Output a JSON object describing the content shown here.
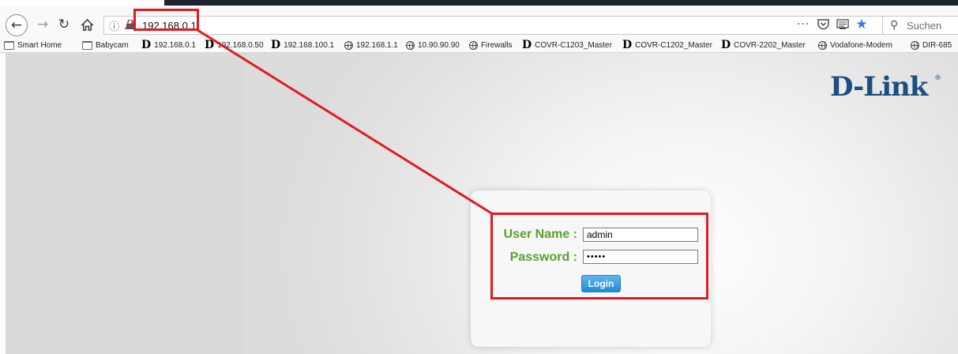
{
  "browser": {
    "url": "192.168.0.1",
    "search_placeholder": "Suchen",
    "icons": {
      "back": "arrow-left-icon",
      "forward": "arrow-right-icon",
      "reload": "reload-icon",
      "home": "home-icon",
      "info": "info-icon",
      "more": "more-icon",
      "pocket": "pocket-icon",
      "reader": "reader-view-icon",
      "bookmark_star": "star-icon",
      "search": "search-icon"
    },
    "accent_color": "#2f7ed8"
  },
  "bookmarks": [
    {
      "label": "Smart Home",
      "icon": "folder-icon"
    },
    {
      "label": "Babycam",
      "icon": "folder-icon"
    },
    {
      "label": "192.168.0.1",
      "icon": "dlink-icon"
    },
    {
      "label": "192.168.0.50",
      "icon": "dlink-icon"
    },
    {
      "label": "192.168.100.1",
      "icon": "dlink-icon"
    },
    {
      "label": "192.168.1.1",
      "icon": "globe-icon"
    },
    {
      "label": "10.90.90.90",
      "icon": "globe-icon"
    },
    {
      "label": "Firewalls",
      "icon": "globe-icon"
    },
    {
      "label": "COVR-C1203_Master",
      "icon": "dlink-icon"
    },
    {
      "label": "COVR-C1202_Master",
      "icon": "dlink-icon"
    },
    {
      "label": "COVR-2202_Master",
      "icon": "dlink-icon"
    },
    {
      "label": "Vodafone-Modem",
      "icon": "globe-icon"
    },
    {
      "label": "DIR-685",
      "icon": "globe-icon"
    }
  ],
  "page": {
    "logo_text": "D-Link",
    "logo_mark": "®",
    "brand_color": "#1a4f80",
    "label_color": "#5aa12a",
    "annotation_color": "#e01b23",
    "login": {
      "username_label": "User Name :",
      "username_value": "admin",
      "password_label": "Password :",
      "password_value": "•••••",
      "login_button": "Login"
    }
  }
}
